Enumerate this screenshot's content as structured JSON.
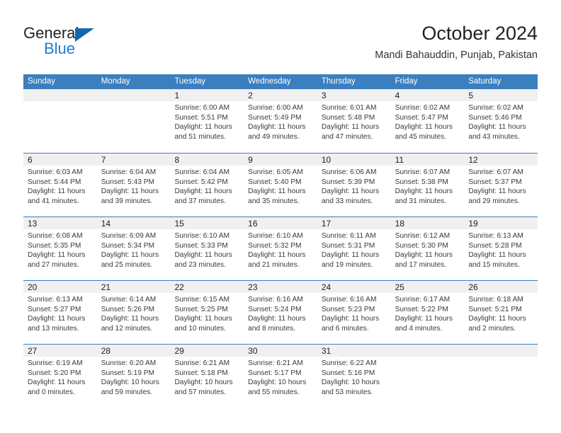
{
  "brand": {
    "name_top": "General",
    "name_bottom": "Blue",
    "triangle_color": "#1665b0",
    "blue_color": "#1b7fd4"
  },
  "header": {
    "title": "October 2024",
    "subtitle": "Mandi Bahauddin, Punjab, Pakistan"
  },
  "theme": {
    "header_bar": "#3b7fbf",
    "day_band": "#f0f0f0",
    "row_divider": "#3b7fbf",
    "text": "#222222"
  },
  "weekdays": [
    "Sunday",
    "Monday",
    "Tuesday",
    "Wednesday",
    "Thursday",
    "Friday",
    "Saturday"
  ],
  "labels": {
    "sunrise_prefix": "Sunrise:",
    "sunset_prefix": "Sunset:",
    "daylight_prefix": "Daylight:"
  },
  "weeks": [
    [
      {
        "blank": true
      },
      {
        "blank": true
      },
      {
        "day": "1",
        "sunrise": "Sunrise: 6:00 AM",
        "sunset": "Sunset: 5:51 PM",
        "daylight_l1": "Daylight: 11 hours",
        "daylight_l2": "and 51 minutes."
      },
      {
        "day": "2",
        "sunrise": "Sunrise: 6:00 AM",
        "sunset": "Sunset: 5:49 PM",
        "daylight_l1": "Daylight: 11 hours",
        "daylight_l2": "and 49 minutes."
      },
      {
        "day": "3",
        "sunrise": "Sunrise: 6:01 AM",
        "sunset": "Sunset: 5:48 PM",
        "daylight_l1": "Daylight: 11 hours",
        "daylight_l2": "and 47 minutes."
      },
      {
        "day": "4",
        "sunrise": "Sunrise: 6:02 AM",
        "sunset": "Sunset: 5:47 PM",
        "daylight_l1": "Daylight: 11 hours",
        "daylight_l2": "and 45 minutes."
      },
      {
        "day": "5",
        "sunrise": "Sunrise: 6:02 AM",
        "sunset": "Sunset: 5:46 PM",
        "daylight_l1": "Daylight: 11 hours",
        "daylight_l2": "and 43 minutes."
      }
    ],
    [
      {
        "day": "6",
        "sunrise": "Sunrise: 6:03 AM",
        "sunset": "Sunset: 5:44 PM",
        "daylight_l1": "Daylight: 11 hours",
        "daylight_l2": "and 41 minutes."
      },
      {
        "day": "7",
        "sunrise": "Sunrise: 6:04 AM",
        "sunset": "Sunset: 5:43 PM",
        "daylight_l1": "Daylight: 11 hours",
        "daylight_l2": "and 39 minutes."
      },
      {
        "day": "8",
        "sunrise": "Sunrise: 6:04 AM",
        "sunset": "Sunset: 5:42 PM",
        "daylight_l1": "Daylight: 11 hours",
        "daylight_l2": "and 37 minutes."
      },
      {
        "day": "9",
        "sunrise": "Sunrise: 6:05 AM",
        "sunset": "Sunset: 5:40 PM",
        "daylight_l1": "Daylight: 11 hours",
        "daylight_l2": "and 35 minutes."
      },
      {
        "day": "10",
        "sunrise": "Sunrise: 6:06 AM",
        "sunset": "Sunset: 5:39 PM",
        "daylight_l1": "Daylight: 11 hours",
        "daylight_l2": "and 33 minutes."
      },
      {
        "day": "11",
        "sunrise": "Sunrise: 6:07 AM",
        "sunset": "Sunset: 5:38 PM",
        "daylight_l1": "Daylight: 11 hours",
        "daylight_l2": "and 31 minutes."
      },
      {
        "day": "12",
        "sunrise": "Sunrise: 6:07 AM",
        "sunset": "Sunset: 5:37 PM",
        "daylight_l1": "Daylight: 11 hours",
        "daylight_l2": "and 29 minutes."
      }
    ],
    [
      {
        "day": "13",
        "sunrise": "Sunrise: 6:08 AM",
        "sunset": "Sunset: 5:35 PM",
        "daylight_l1": "Daylight: 11 hours",
        "daylight_l2": "and 27 minutes."
      },
      {
        "day": "14",
        "sunrise": "Sunrise: 6:09 AM",
        "sunset": "Sunset: 5:34 PM",
        "daylight_l1": "Daylight: 11 hours",
        "daylight_l2": "and 25 minutes."
      },
      {
        "day": "15",
        "sunrise": "Sunrise: 6:10 AM",
        "sunset": "Sunset: 5:33 PM",
        "daylight_l1": "Daylight: 11 hours",
        "daylight_l2": "and 23 minutes."
      },
      {
        "day": "16",
        "sunrise": "Sunrise: 6:10 AM",
        "sunset": "Sunset: 5:32 PM",
        "daylight_l1": "Daylight: 11 hours",
        "daylight_l2": "and 21 minutes."
      },
      {
        "day": "17",
        "sunrise": "Sunrise: 6:11 AM",
        "sunset": "Sunset: 5:31 PM",
        "daylight_l1": "Daylight: 11 hours",
        "daylight_l2": "and 19 minutes."
      },
      {
        "day": "18",
        "sunrise": "Sunrise: 6:12 AM",
        "sunset": "Sunset: 5:30 PM",
        "daylight_l1": "Daylight: 11 hours",
        "daylight_l2": "and 17 minutes."
      },
      {
        "day": "19",
        "sunrise": "Sunrise: 6:13 AM",
        "sunset": "Sunset: 5:28 PM",
        "daylight_l1": "Daylight: 11 hours",
        "daylight_l2": "and 15 minutes."
      }
    ],
    [
      {
        "day": "20",
        "sunrise": "Sunrise: 6:13 AM",
        "sunset": "Sunset: 5:27 PM",
        "daylight_l1": "Daylight: 11 hours",
        "daylight_l2": "and 13 minutes."
      },
      {
        "day": "21",
        "sunrise": "Sunrise: 6:14 AM",
        "sunset": "Sunset: 5:26 PM",
        "daylight_l1": "Daylight: 11 hours",
        "daylight_l2": "and 12 minutes."
      },
      {
        "day": "22",
        "sunrise": "Sunrise: 6:15 AM",
        "sunset": "Sunset: 5:25 PM",
        "daylight_l1": "Daylight: 11 hours",
        "daylight_l2": "and 10 minutes."
      },
      {
        "day": "23",
        "sunrise": "Sunrise: 6:16 AM",
        "sunset": "Sunset: 5:24 PM",
        "daylight_l1": "Daylight: 11 hours",
        "daylight_l2": "and 8 minutes."
      },
      {
        "day": "24",
        "sunrise": "Sunrise: 6:16 AM",
        "sunset": "Sunset: 5:23 PM",
        "daylight_l1": "Daylight: 11 hours",
        "daylight_l2": "and 6 minutes."
      },
      {
        "day": "25",
        "sunrise": "Sunrise: 6:17 AM",
        "sunset": "Sunset: 5:22 PM",
        "daylight_l1": "Daylight: 11 hours",
        "daylight_l2": "and 4 minutes."
      },
      {
        "day": "26",
        "sunrise": "Sunrise: 6:18 AM",
        "sunset": "Sunset: 5:21 PM",
        "daylight_l1": "Daylight: 11 hours",
        "daylight_l2": "and 2 minutes."
      }
    ],
    [
      {
        "day": "27",
        "sunrise": "Sunrise: 6:19 AM",
        "sunset": "Sunset: 5:20 PM",
        "daylight_l1": "Daylight: 11 hours",
        "daylight_l2": "and 0 minutes."
      },
      {
        "day": "28",
        "sunrise": "Sunrise: 6:20 AM",
        "sunset": "Sunset: 5:19 PM",
        "daylight_l1": "Daylight: 10 hours",
        "daylight_l2": "and 59 minutes."
      },
      {
        "day": "29",
        "sunrise": "Sunrise: 6:21 AM",
        "sunset": "Sunset: 5:18 PM",
        "daylight_l1": "Daylight: 10 hours",
        "daylight_l2": "and 57 minutes."
      },
      {
        "day": "30",
        "sunrise": "Sunrise: 6:21 AM",
        "sunset": "Sunset: 5:17 PM",
        "daylight_l1": "Daylight: 10 hours",
        "daylight_l2": "and 55 minutes."
      },
      {
        "day": "31",
        "sunrise": "Sunrise: 6:22 AM",
        "sunset": "Sunset: 5:16 PM",
        "daylight_l1": "Daylight: 10 hours",
        "daylight_l2": "and 53 minutes."
      },
      {
        "blank": true
      },
      {
        "blank": true
      }
    ]
  ]
}
